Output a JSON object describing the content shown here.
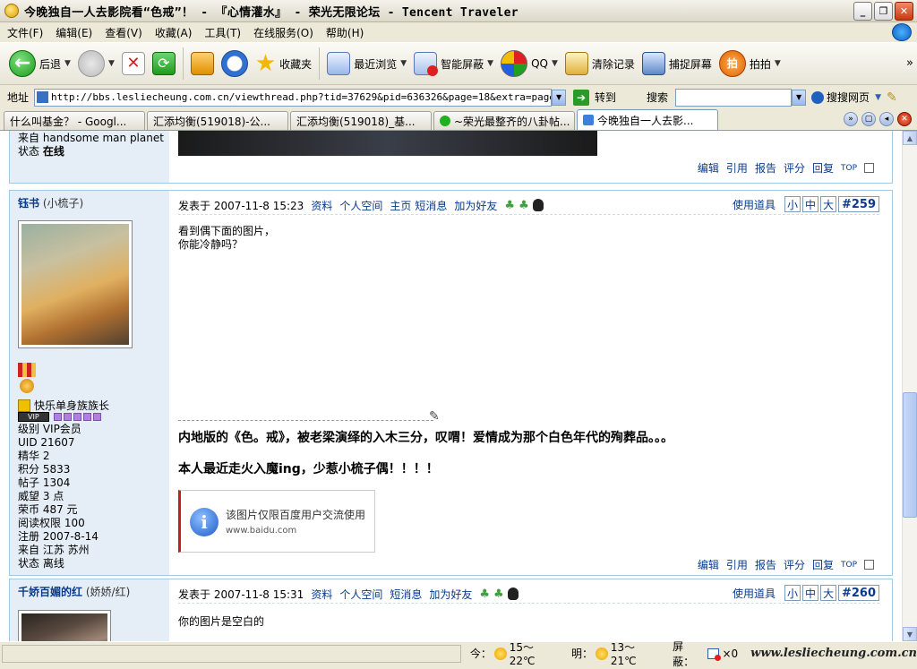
{
  "window": {
    "title": "今晚独自一人去影院看“色戒”！ - 『心情灌水』 - 荣光无限论坛 - Tencent Traveler"
  },
  "menu": [
    "文件(F)",
    "编辑(E)",
    "查看(V)",
    "收藏(A)",
    "工具(T)",
    "在线服务(O)",
    "帮助(H)"
  ],
  "toolbar": {
    "back": "后退",
    "favorites": "收藏夹",
    "recent": "最近浏览",
    "blocker": "智能屏蔽",
    "qq": "QQ",
    "clear": "清除记录",
    "capture": "捕捉屏幕",
    "paipai": "拍拍",
    "more": "»"
  },
  "address": {
    "label": "地址",
    "url": "http://bbs.lesliecheung.com.cn/viewthread.php?tid=37629&pid=636326&page=18&extra=page%3D1#pid6",
    "go": "转到",
    "search_label": "搜索",
    "search_engine": "搜搜网页"
  },
  "tabs": [
    {
      "label": "什么叫基金？ - Googl..."
    },
    {
      "label": "汇添均衡(519018)-公..."
    },
    {
      "label": "汇添均衡(519018)_基..."
    },
    {
      "label": "~荣光最整齐的八卦帖..."
    },
    {
      "label": "今晚独自一人去影..."
    }
  ],
  "prev_post": {
    "from": "来自 handsome man planet",
    "status_label": "状态",
    "status": "在线",
    "actions": [
      "编辑",
      "引用",
      "报告",
      "评分",
      "回复",
      "TOP"
    ]
  },
  "post259": {
    "username": "钰书",
    "nickname": "(小梳子)",
    "posted": "发表于 2007-11-8 15:23",
    "links": [
      "资料",
      "个人空间",
      "主页",
      "短消息",
      "加为好友"
    ],
    "tools": "使用道具",
    "sizes": [
      "小",
      "中",
      "大"
    ],
    "number": "#259",
    "line1": "看到偶下面的图片，",
    "line2": "你能冷静吗？",
    "bold1": "内地版的《色。戒》，被老梁演绎的入木三分，叹喟！爱情成为那个白色年代的殉葬品。。。",
    "bold2": "本人最近走火入魔ing，少惹小梳子偶！！！！",
    "baidu_text": "该图片仅限百度用户交流使用",
    "baidu_url": "www.baidu.com",
    "user_title": "快乐单身族族长",
    "vip": "VIP",
    "info": [
      "级别 VIP会员",
      "UID 21607",
      "精华 2",
      "积分 5833",
      "帖子 1304",
      "威望 3 点",
      "荣币 487 元",
      "阅读权限 100",
      "注册 2007-8-14",
      "来自 江苏 苏州",
      "状态 离线"
    ],
    "actions": [
      "编辑",
      "引用",
      "报告",
      "评分",
      "回复",
      "TOP"
    ]
  },
  "post260": {
    "username": "千娇百媚的红",
    "nickname": "(娇娇/红)",
    "posted": "发表于 2007-11-8 15:31",
    "links": [
      "资料",
      "个人空间",
      "短消息",
      "加为好友"
    ],
    "tools": "使用道具",
    "sizes": [
      "小",
      "中",
      "大"
    ],
    "number": "#260",
    "text": "你的图片是空白的"
  },
  "status": {
    "today_label": "今：",
    "today": "15～22℃",
    "tomorrow_label": "明：",
    "tomorrow": "13～21℃",
    "block_label": "屏蔽：",
    "block_count": "×0",
    "watermark": "www.lesliecheung.com.cn"
  }
}
